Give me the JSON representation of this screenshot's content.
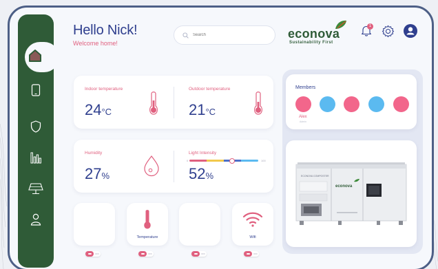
{
  "header": {
    "greeting": "Hello Nick!",
    "subtitle": "Welcome home!",
    "search_placeholder": "Search",
    "notification_count": "1"
  },
  "logo": {
    "name": "econova",
    "tagline": "Sustainability First"
  },
  "sidebar": {
    "items": [
      {
        "icon": "home-icon",
        "active": true
      },
      {
        "icon": "tablet-icon"
      },
      {
        "icon": "shield-icon"
      },
      {
        "icon": "bar-chart-icon"
      },
      {
        "icon": "solar-panel-icon"
      },
      {
        "icon": "user-icon"
      }
    ]
  },
  "temperature": {
    "indoor_label": "Indoor temperature",
    "indoor_value": "24",
    "outdoor_label": "Outdoor temperature",
    "outdoor_value": "21",
    "unit": "°C"
  },
  "humidity": {
    "label": "Humidity",
    "value": "27",
    "unit": "%"
  },
  "light": {
    "label": "Light Intensity",
    "value": "52",
    "unit": "%",
    "scale_min": "0",
    "scale_max": "100",
    "level_percent": 62
  },
  "members": {
    "title": "Members",
    "first_name": "Alex",
    "first_sub": "Admin",
    "colors": [
      "#f2668b",
      "#5bbaf0",
      "#f2668b",
      "#5bbaf0",
      "#f2668b"
    ]
  },
  "devices": [
    {
      "label": "",
      "icon": "",
      "toggle": "OFF"
    },
    {
      "label": "Temperature",
      "icon": "thermometer-icon",
      "toggle": "OFF"
    },
    {
      "label": "",
      "icon": "",
      "toggle": "OFF"
    },
    {
      "label": "Wifi",
      "icon": "wifi-icon",
      "toggle": "OFF"
    }
  ],
  "composter": {
    "brand_text": "econova",
    "panel_text": "ECONOVA COMPOSTER"
  },
  "colors": {
    "sidebar": "#2f5b37",
    "accent_pink": "#e0607f",
    "accent_blue": "#5bbaf0",
    "text_primary": "#2f3f8e",
    "frame": "#4d5f86"
  }
}
